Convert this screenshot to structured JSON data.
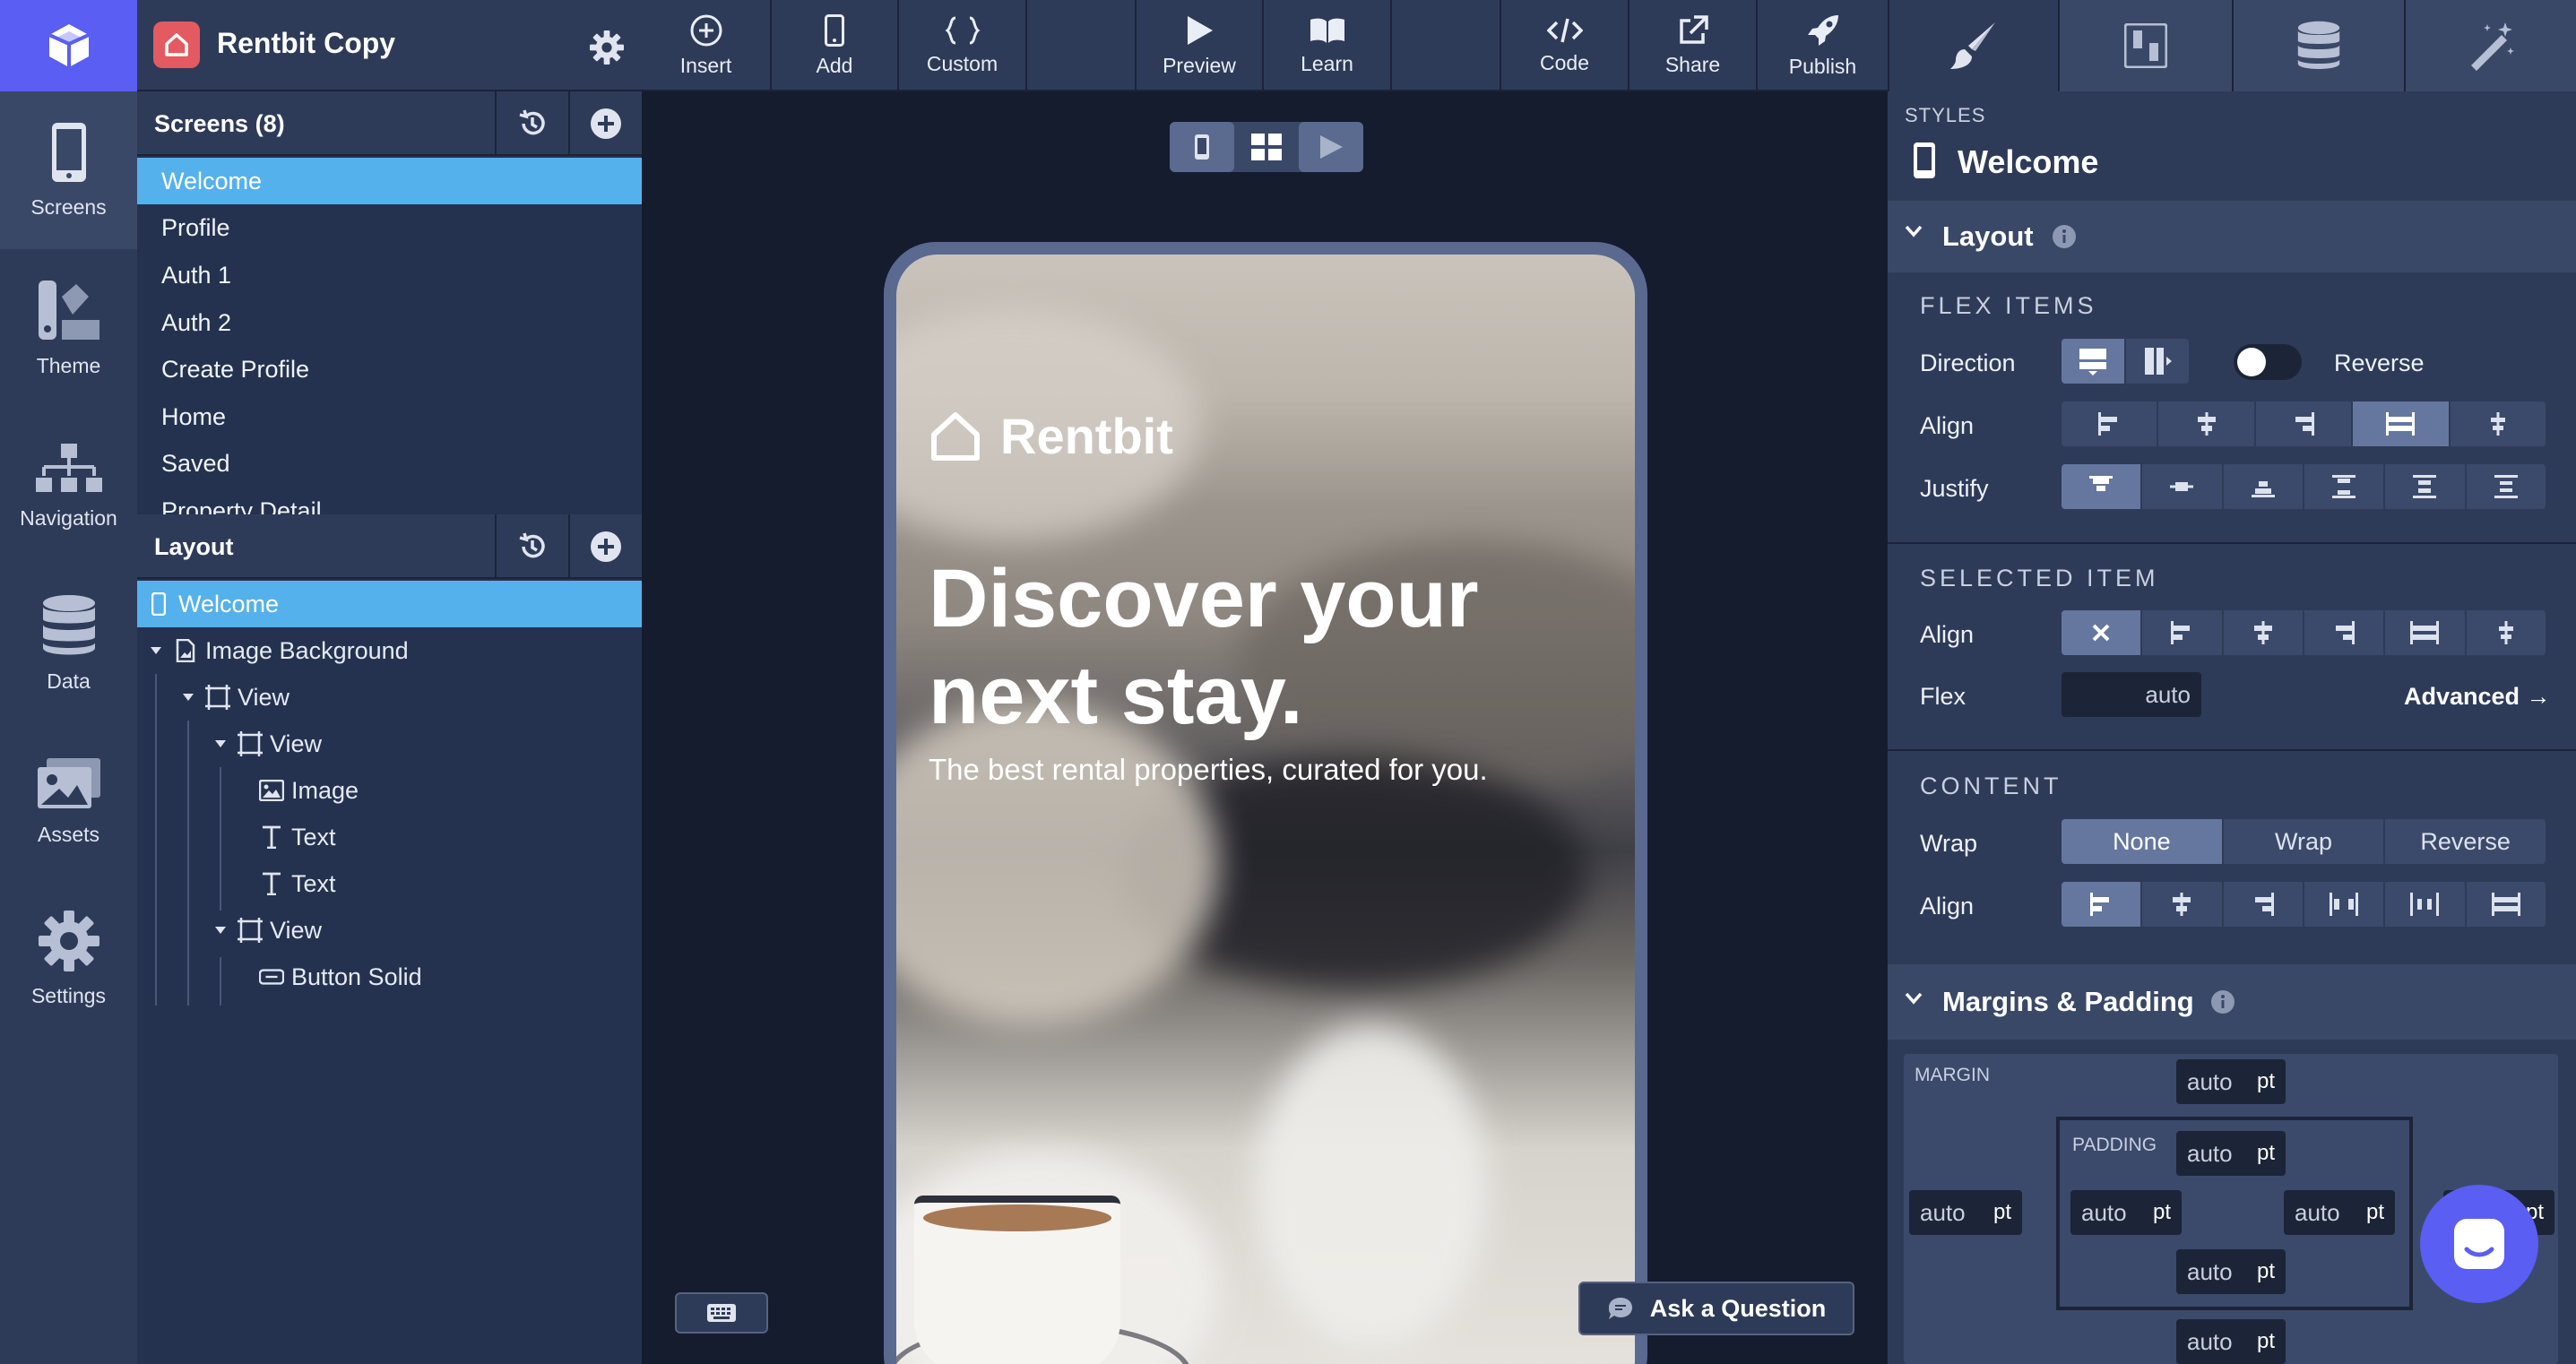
{
  "rail": {
    "items": [
      {
        "label": "Screens",
        "icon": "phone-icon"
      },
      {
        "label": "Theme",
        "icon": "theme-icon"
      },
      {
        "label": "Navigation",
        "icon": "sitemap-icon"
      },
      {
        "label": "Data",
        "icon": "database-icon"
      },
      {
        "label": "Assets",
        "icon": "images-icon"
      },
      {
        "label": "Settings",
        "icon": "gear-icon"
      }
    ]
  },
  "project": {
    "name": "Rentbit Copy"
  },
  "screens": {
    "title": "Screens (8)",
    "items": [
      "Welcome",
      "Profile",
      "Auth 1",
      "Auth 2",
      "Create Profile",
      "Home",
      "Saved",
      "Property Detail"
    ],
    "selected": "Welcome"
  },
  "layout": {
    "title": "Layout",
    "tree": [
      {
        "label": "Welcome",
        "icon": "phone-icon"
      },
      {
        "label": "Image Background",
        "icon": "file-image-icon"
      },
      {
        "label": "View",
        "icon": "view-icon"
      },
      {
        "label": "View",
        "icon": "view-icon"
      },
      {
        "label": "Image",
        "icon": "image-icon"
      },
      {
        "label": "Text",
        "icon": "text-icon"
      },
      {
        "label": "Text",
        "icon": "text-icon"
      },
      {
        "label": "View",
        "icon": "view-icon"
      },
      {
        "label": "Button Solid",
        "icon": "button-icon"
      }
    ]
  },
  "toolbar": {
    "insert": "Insert",
    "add": "Add",
    "custom": "Custom",
    "preview": "Preview",
    "learn": "Learn",
    "code": "Code",
    "share": "Share",
    "publish": "Publish"
  },
  "phone": {
    "brand": "Rentbit",
    "headline": "Discover your next stay.",
    "subhead": "The best rental properties, curated for you."
  },
  "canvas": {
    "ask_question": "Ask a Question"
  },
  "styles": {
    "caption": "STYLES",
    "screen_name": "Welcome",
    "layout_title": "Layout",
    "flex_items": "FLEX ITEMS",
    "direction": "Direction",
    "reverse": "Reverse",
    "align": "Align",
    "justify": "Justify",
    "selected_item": "SELECTED ITEM",
    "flex": "Flex",
    "flex_value": "auto",
    "advanced": "Advanced →",
    "content": "CONTENT",
    "wrap": "Wrap",
    "wrap_options": [
      "None",
      "Wrap",
      "Reverse"
    ],
    "wrap_selected": "None",
    "margins_title": "Margins & Padding",
    "margin_label": "MARGIN",
    "padding_label": "PADDING",
    "auto": "auto",
    "unit": "pt"
  },
  "colors": {
    "accent": "#5a5ef2",
    "selection": "#55b1ec",
    "project": "#e35b60"
  }
}
